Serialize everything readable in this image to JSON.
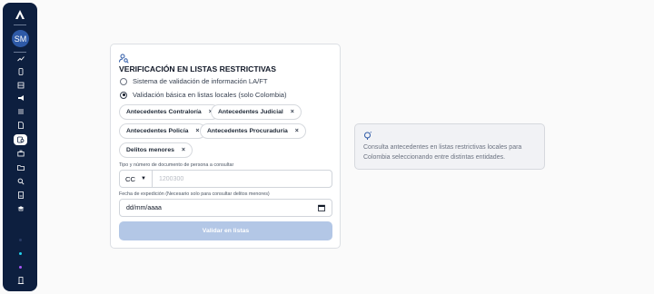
{
  "sidebar": {
    "avatar_initials": "SM",
    "active_item": "search-document",
    "items": [
      {
        "name": "analytics",
        "icon": "trend-line-icon"
      },
      {
        "name": "file",
        "icon": "file-icon"
      },
      {
        "name": "records",
        "icon": "stack-icon"
      },
      {
        "name": "campaigns",
        "icon": "megaphone-icon"
      },
      {
        "name": "list",
        "icon": "list-icon"
      },
      {
        "name": "document",
        "icon": "document-icon"
      },
      {
        "name": "search-document",
        "icon": "search-document-icon"
      },
      {
        "name": "briefcase",
        "icon": "briefcase-icon"
      },
      {
        "name": "folder",
        "icon": "folder-icon"
      },
      {
        "name": "search",
        "icon": "magnifier-icon"
      },
      {
        "name": "report",
        "icon": "report-icon"
      },
      {
        "name": "graduation",
        "icon": "graduation-cap-icon"
      }
    ],
    "dots": [
      "#2a3c66",
      "#22d3ee",
      "#a855f7"
    ],
    "bottom_icon": "building-icon"
  },
  "form": {
    "title": "VERIFICACIÓN EN LISTAS RESTRICTIVAS",
    "options": [
      {
        "label": "Sistema de validación de información LA/FT",
        "checked": false
      },
      {
        "label": "Validación básica en listas locales (solo Colombia)",
        "checked": true
      }
    ],
    "chips": [
      "Antecedentes Contraloría",
      "Antecedentes Judicial",
      "Antecedentes Policía",
      "Antecedentes Procuraduría",
      "Delitos menores"
    ],
    "chip_remove_symbol": "×",
    "doc_label": "Tipo y número de documento de persona a consultar",
    "doc_type": "CC",
    "doc_number_placeholder": "1200300",
    "date_label": "Fecha de expedición (Necesario solo para consultar delitos menores)",
    "date_placeholder": "dd/mm/aaaa",
    "submit_label": "Validar en listas"
  },
  "info": {
    "text": "Consulta antecedentes en listas restrictivas locales para Colombia seleccionando entre distintas entidades."
  },
  "colors": {
    "sidebar_bg": "#0d1f3f",
    "accent": "#2e5aa7",
    "button_disabled": "#b3c7e6"
  }
}
